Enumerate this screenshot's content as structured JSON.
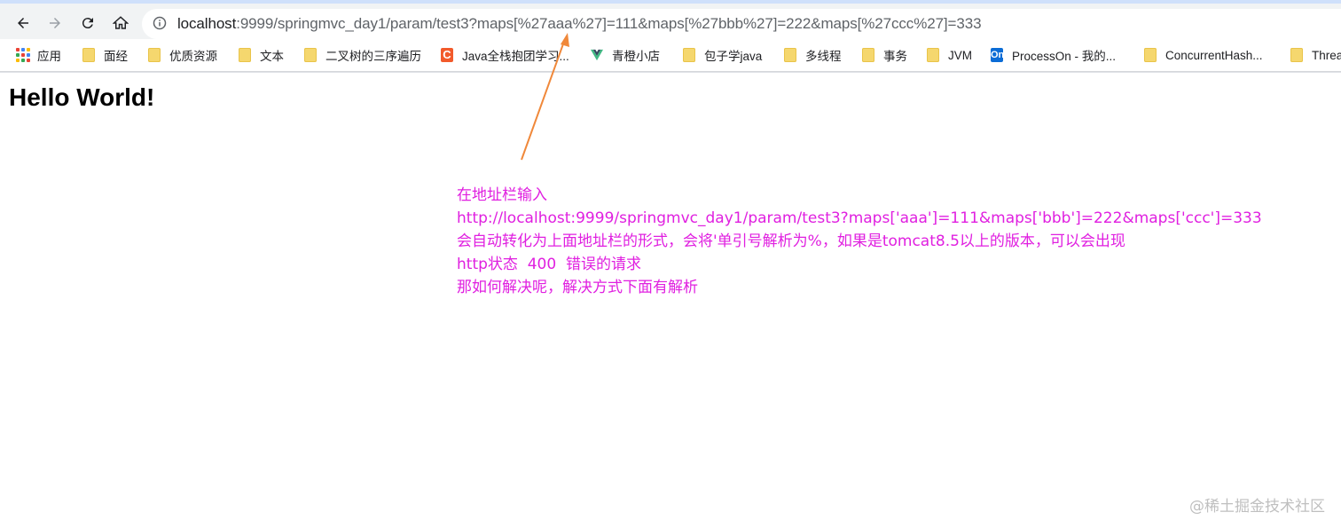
{
  "browser": {
    "url_host": "localhost",
    "url_rest": ":9999/springmvc_day1/param/test3?maps[%27aaa%27]=111&maps[%27bbb%27]=222&maps[%27ccc%27]=333"
  },
  "bookmarks": [
    {
      "label": "应用",
      "icon": "apps-icon"
    },
    {
      "label": "面经",
      "icon": "folder-icon"
    },
    {
      "label": "优质资源",
      "icon": "folder-icon"
    },
    {
      "label": "文本",
      "icon": "folder-icon"
    },
    {
      "label": "二叉树的三序遍历",
      "icon": "folder-icon"
    },
    {
      "label": "Java全栈抱团学习...",
      "icon": "c-icon"
    },
    {
      "label": "青橙小店",
      "icon": "vue-icon"
    },
    {
      "label": "包子学java",
      "icon": "folder-icon"
    },
    {
      "label": "多线程",
      "icon": "folder-icon"
    },
    {
      "label": "事务",
      "icon": "folder-icon"
    },
    {
      "label": "JVM",
      "icon": "folder-icon"
    },
    {
      "label": "ProcessOn - 我的...",
      "icon": "processon-icon"
    },
    {
      "label": "ConcurrentHash...",
      "icon": "folder-icon"
    },
    {
      "label": "Threa",
      "icon": "folder-icon"
    }
  ],
  "page": {
    "heading": "Hello World!"
  },
  "annotation": {
    "lines": [
      "在地址栏输入",
      "http://localhost:9999/springmvc_day1/param/test3?maps['aaa']=111&maps['bbb']=222&maps['ccc']=333",
      "会自动转化为上面地址栏的形式，会将'单引号解析为%，如果是tomcat8.5以上的版本，可以会出现",
      "http状态  400  错误的请求",
      "那如何解决呢，解决方式下面有解析"
    ],
    "color": "#e020e0",
    "arrow_color": "#f0883a"
  },
  "watermark": "@稀土掘金技术社区",
  "colors": {
    "toolbar": "#f1f3f4",
    "accent": "#cfe0fb"
  }
}
